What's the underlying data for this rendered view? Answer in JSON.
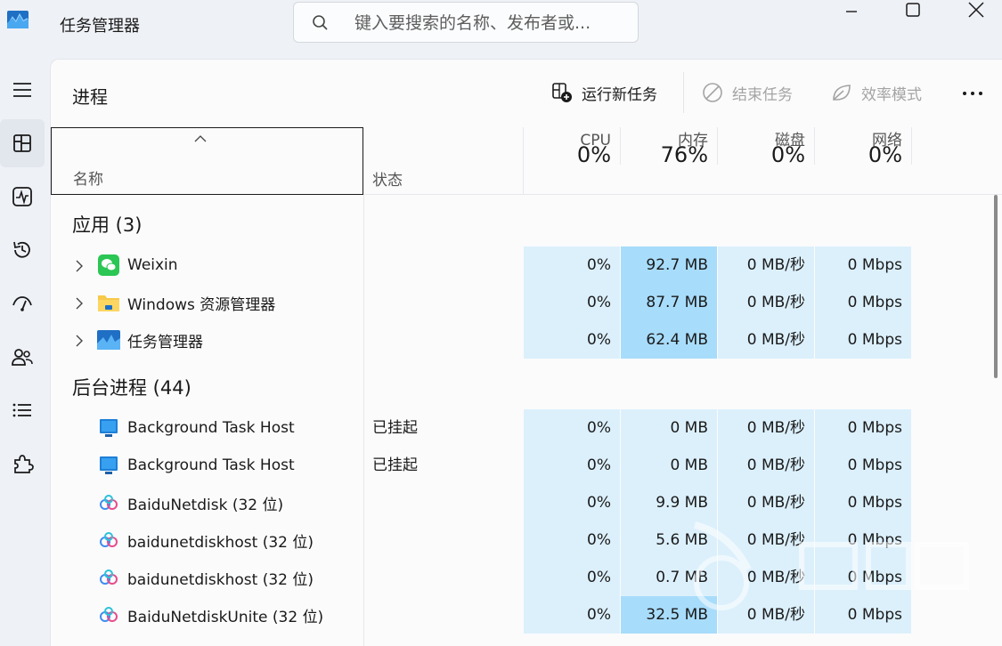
{
  "window": {
    "title": "任务管理器"
  },
  "search": {
    "placeholder": "键入要搜索的名称、发布者或..."
  },
  "nav": {
    "items": [
      "menu",
      "processes",
      "performance",
      "app-history",
      "startup",
      "users",
      "details",
      "services"
    ],
    "active": "processes"
  },
  "page": {
    "title": "进程"
  },
  "toolbar": {
    "run_new_task": "运行新任务",
    "end_task": "结束任务",
    "efficiency_mode": "效率模式"
  },
  "columns": {
    "name": "名称",
    "status": "状态",
    "cpu": {
      "label": "CPU",
      "pct": "0%"
    },
    "memory": {
      "label": "内存",
      "pct": "76%"
    },
    "disk": {
      "label": "磁盘",
      "pct": "0%"
    },
    "network": {
      "label": "网络",
      "pct": "0%"
    }
  },
  "groups": {
    "apps": "应用 (3)",
    "background": "后台进程 (44)"
  },
  "apps": [
    {
      "name": "Weixin",
      "icon": "weixin-icon",
      "status": "",
      "cpu": "0%",
      "memory": "92.7 MB",
      "disk": "0 MB/秒",
      "network": "0 Mbps"
    },
    {
      "name": "Windows 资源管理器",
      "icon": "explorer-folder-icon",
      "status": "",
      "cpu": "0%",
      "memory": "87.7 MB",
      "disk": "0 MB/秒",
      "network": "0 Mbps"
    },
    {
      "name": "任务管理器",
      "icon": "task-manager-icon",
      "status": "",
      "cpu": "0%",
      "memory": "62.4 MB",
      "disk": "0 MB/秒",
      "network": "0 Mbps"
    }
  ],
  "background": [
    {
      "name": "Background Task Host",
      "icon": "background-task-host-icon",
      "status": "已挂起",
      "cpu": "0%",
      "memory": "0 MB",
      "disk": "0 MB/秒",
      "network": "0 Mbps"
    },
    {
      "name": "Background Task Host",
      "icon": "background-task-host-icon",
      "status": "已挂起",
      "cpu": "0%",
      "memory": "0 MB",
      "disk": "0 MB/秒",
      "network": "0 Mbps"
    },
    {
      "name": "BaiduNetdisk (32 位)",
      "icon": "baidu-netdisk-icon",
      "status": "",
      "cpu": "0%",
      "memory": "9.9 MB",
      "disk": "0 MB/秒",
      "network": "0 Mbps"
    },
    {
      "name": "baidunetdiskhost (32 位)",
      "icon": "baidu-netdisk-icon",
      "status": "",
      "cpu": "0%",
      "memory": "5.6 MB",
      "disk": "0 MB/秒",
      "network": "0 Mbps"
    },
    {
      "name": "baidunetdiskhost (32 位)",
      "icon": "baidu-netdisk-icon",
      "status": "",
      "cpu": "0%",
      "memory": "0.7 MB",
      "disk": "0 MB/秒",
      "network": "0 Mbps"
    },
    {
      "name": "BaiduNetdiskUnite (32 位)",
      "icon": "baidu-netdisk-icon",
      "status": "",
      "cpu": "0%",
      "memory": "32.5 MB",
      "disk": "0 MB/秒",
      "network": "0 Mbps"
    }
  ],
  "colors": {
    "cell": "#dcf0fc",
    "cell_high": "#a8dcfb"
  }
}
